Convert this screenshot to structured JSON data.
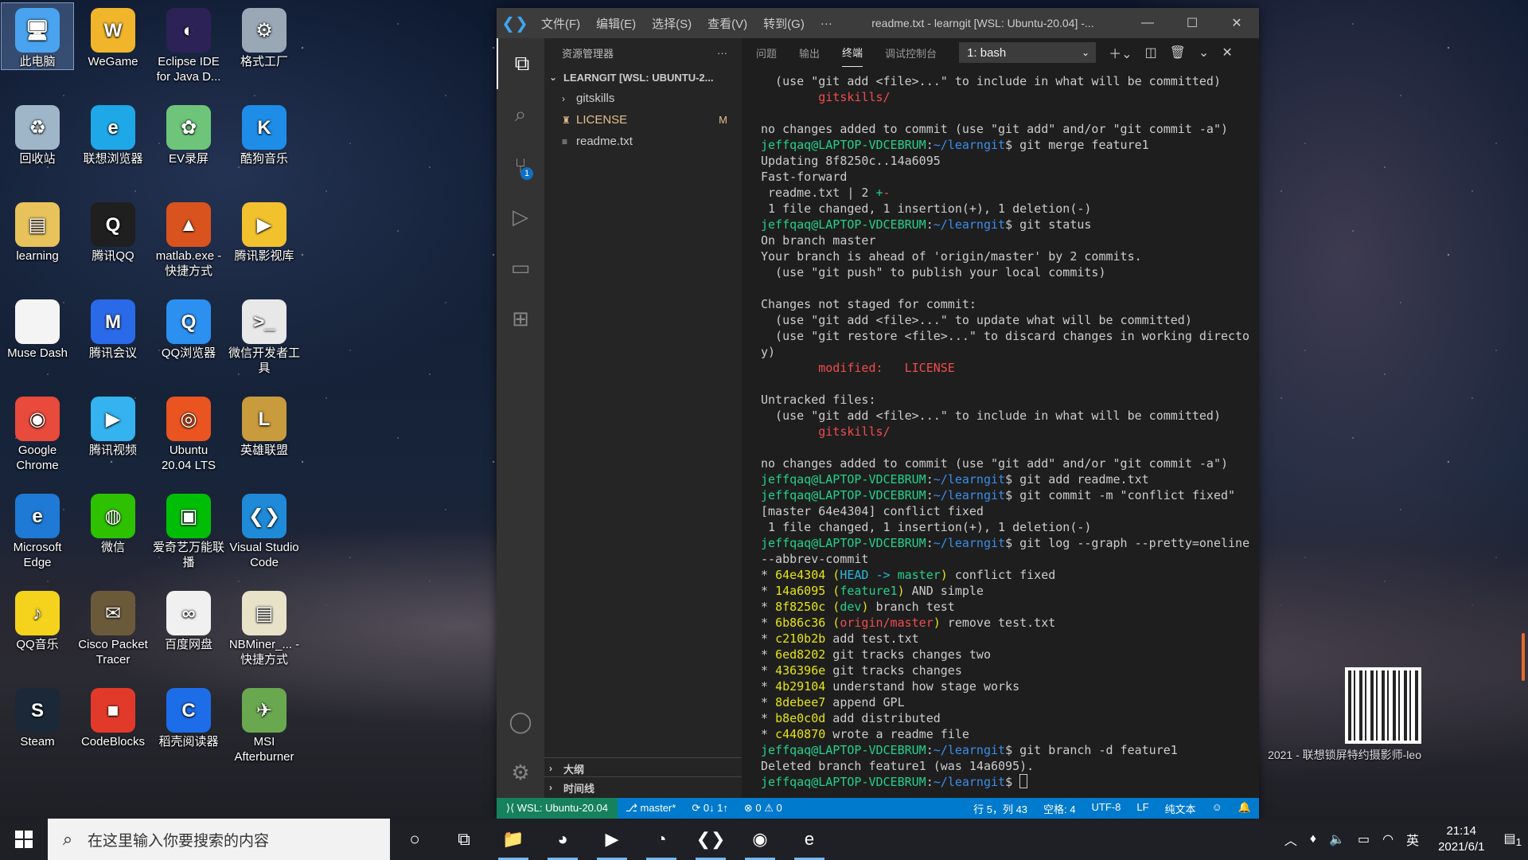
{
  "desktop": {
    "icons": [
      {
        "label": "此电脑",
        "color": "#4aa3ef",
        "glyph": "🖥"
      },
      {
        "label": "WeGame",
        "color": "#f0b52b",
        "glyph": "W"
      },
      {
        "label": "Eclipse IDE for Java D...",
        "color": "#2c2255",
        "glyph": "◐"
      },
      {
        "label": "格式工厂",
        "color": "#9aa7b5",
        "glyph": "⚙"
      },
      {
        "label": "回收站",
        "color": "#9fb6c8",
        "glyph": "♻"
      },
      {
        "label": "联想浏览器",
        "color": "#1ea8e8",
        "glyph": "e"
      },
      {
        "label": "EV录屏",
        "color": "#6ec57a",
        "glyph": "✿"
      },
      {
        "label": "酷狗音乐",
        "color": "#1d8de8",
        "glyph": "K"
      },
      {
        "label": "learning",
        "color": "#e8c25a",
        "glyph": "▤"
      },
      {
        "label": "腾讯QQ",
        "color": "#1f1f1f",
        "glyph": "Q"
      },
      {
        "label": "matlab.exe - 快捷方式",
        "color": "#d9531e",
        "glyph": "▲"
      },
      {
        "label": "腾讯影视库",
        "color": "#f2c12e",
        "glyph": "▶"
      },
      {
        "label": "Muse Dash",
        "color": "#f4f4f4",
        "glyph": " "
      },
      {
        "label": "腾讯会议",
        "color": "#2a6ae8",
        "glyph": "M"
      },
      {
        "label": "QQ浏览器",
        "color": "#2c90f0",
        "glyph": "Q"
      },
      {
        "label": "微信开发者工具",
        "color": "#e8e8e8",
        "glyph": ">_"
      },
      {
        "label": "Google Chrome",
        "color": "#e84a3c",
        "glyph": "◉"
      },
      {
        "label": "腾讯视频",
        "color": "#34b3f0",
        "glyph": "▶"
      },
      {
        "label": "Ubuntu 20.04 LTS",
        "color": "#e95420",
        "glyph": "◎"
      },
      {
        "label": "英雄联盟",
        "color": "#c89b3c",
        "glyph": "L"
      },
      {
        "label": "Microsoft Edge",
        "color": "#1e7ad4",
        "glyph": "e"
      },
      {
        "label": "微信",
        "color": "#2dc100",
        "glyph": "◍"
      },
      {
        "label": "爱奇艺万能联播",
        "color": "#00be06",
        "glyph": "▣"
      },
      {
        "label": "Visual Studio Code",
        "color": "#1f8ad8",
        "glyph": "❮❯"
      },
      {
        "label": "QQ音乐",
        "color": "#f5d21c",
        "glyph": "♪"
      },
      {
        "label": "Cisco Packet Tracer",
        "color": "#6b5a3a",
        "glyph": "✉"
      },
      {
        "label": "百度网盘",
        "color": "#f0f0f0",
        "glyph": "∞"
      },
      {
        "label": "NBMiner_... - 快捷方式",
        "color": "#e8e2c8",
        "glyph": "▤"
      },
      {
        "label": "Steam",
        "color": "#1b2838",
        "glyph": "S"
      },
      {
        "label": "CodeBlocks",
        "color": "#e23a2a",
        "glyph": "■"
      },
      {
        "label": "稻壳阅读器",
        "color": "#1e6de8",
        "glyph": "C"
      },
      {
        "label": "MSI Afterburner",
        "color": "#6aa84f",
        "glyph": "✈"
      }
    ],
    "watermark": "2021 - 联想锁屏特约摄影师-leo"
  },
  "vscode": {
    "menu": [
      "文件(F)",
      "编辑(E)",
      "选择(S)",
      "查看(V)",
      "转到(G)",
      "···"
    ],
    "title": "readme.txt - learngit [WSL: Ubuntu-20.04] -...",
    "sidebar": {
      "header": "资源管理器",
      "more": "···",
      "folder": "LEARNGIT [WSL: UBUNTU-2...",
      "items": [
        {
          "label": "gitskills",
          "kind": "folder",
          "mark": ""
        },
        {
          "label": "LICENSE",
          "kind": "file",
          "mark": "M"
        },
        {
          "label": "readme.txt",
          "kind": "file",
          "mark": ""
        }
      ],
      "outline": "大纲",
      "timeline": "时间线"
    },
    "panel": {
      "tabs": [
        "问题",
        "输出",
        "终端",
        "调试控制台"
      ],
      "active_tab": "终端",
      "terminal_select": "1: bash"
    },
    "terminal_lines": [
      [
        [
          "  (use \"git add <file>...\" to include in what will be committed)",
          ""
        ]
      ],
      [
        [
          "        ",
          ""
        ],
        [
          "gitskills/",
          "r"
        ]
      ],
      [
        [
          "",
          ""
        ]
      ],
      [
        [
          "no changes added to commit (use \"git add\" and/or \"git commit -a\")",
          ""
        ]
      ],
      [
        [
          "jeffqaq@LAPTOP-VDCEBRUM",
          "g"
        ],
        [
          ":",
          ""
        ],
        [
          "~/learngit",
          "b"
        ],
        [
          "$ git merge feature1",
          ""
        ]
      ],
      [
        [
          "Updating 8f8250c..14a6095",
          ""
        ]
      ],
      [
        [
          "Fast-forward",
          ""
        ]
      ],
      [
        [
          " readme.txt | 2 ",
          ""
        ],
        [
          "+",
          "g"
        ],
        [
          "-",
          "r"
        ]
      ],
      [
        [
          " 1 file changed, 1 insertion(+), 1 deletion(-)",
          ""
        ]
      ],
      [
        [
          "jeffqaq@LAPTOP-VDCEBRUM",
          "g"
        ],
        [
          ":",
          ""
        ],
        [
          "~/learngit",
          "b"
        ],
        [
          "$ git status",
          ""
        ]
      ],
      [
        [
          "On branch master",
          ""
        ]
      ],
      [
        [
          "Your branch is ahead of 'origin/master' by 2 commits.",
          ""
        ]
      ],
      [
        [
          "  (use \"git push\" to publish your local commits)",
          ""
        ]
      ],
      [
        [
          "",
          ""
        ]
      ],
      [
        [
          "Changes not staged for commit:",
          ""
        ]
      ],
      [
        [
          "  (use \"git add <file>...\" to update what will be committed)",
          ""
        ]
      ],
      [
        [
          "  (use \"git restore <file>...\" to discard changes in working director",
          ""
        ]
      ],
      [
        [
          "y)",
          ""
        ]
      ],
      [
        [
          "        ",
          ""
        ],
        [
          "modified:   LICENSE",
          "r"
        ]
      ],
      [
        [
          "",
          ""
        ]
      ],
      [
        [
          "Untracked files:",
          ""
        ]
      ],
      [
        [
          "  (use \"git add <file>...\" to include in what will be committed)",
          ""
        ]
      ],
      [
        [
          "        ",
          ""
        ],
        [
          "gitskills/",
          "r"
        ]
      ],
      [
        [
          "",
          ""
        ]
      ],
      [
        [
          "no changes added to commit (use \"git add\" and/or \"git commit -a\")",
          ""
        ]
      ],
      [
        [
          "jeffqaq@LAPTOP-VDCEBRUM",
          "g"
        ],
        [
          ":",
          ""
        ],
        [
          "~/learngit",
          "b"
        ],
        [
          "$ git add readme.txt",
          ""
        ]
      ],
      [
        [
          "jeffqaq@LAPTOP-VDCEBRUM",
          "g"
        ],
        [
          ":",
          ""
        ],
        [
          "~/learngit",
          "b"
        ],
        [
          "$ git commit -m \"conflict fixed\"",
          ""
        ]
      ],
      [
        [
          "[master 64e4304] conflict fixed",
          ""
        ]
      ],
      [
        [
          " 1 file changed, 1 insertion(+), 1 deletion(-)",
          ""
        ]
      ],
      [
        [
          "jeffqaq@LAPTOP-VDCEBRUM",
          "g"
        ],
        [
          ":",
          ""
        ],
        [
          "~/learngit",
          "b"
        ],
        [
          "$ git log --graph --pretty=oneline",
          ""
        ]
      ],
      [
        [
          "--abbrev-commit",
          ""
        ]
      ],
      [
        [
          "* ",
          ""
        ],
        [
          "64e4304",
          "y"
        ],
        [
          " (",
          "y"
        ],
        [
          "HEAD -> ",
          "c"
        ],
        [
          "master",
          "g"
        ],
        [
          ")",
          "y"
        ],
        [
          " conflict fixed",
          ""
        ]
      ],
      [
        [
          "* ",
          ""
        ],
        [
          "14a6095",
          "y"
        ],
        [
          " (",
          "y"
        ],
        [
          "feature1",
          "g"
        ],
        [
          ")",
          "y"
        ],
        [
          " AND simple",
          ""
        ]
      ],
      [
        [
          "* ",
          ""
        ],
        [
          "8f8250c",
          "y"
        ],
        [
          " (",
          "y"
        ],
        [
          "dev",
          "g"
        ],
        [
          ")",
          "y"
        ],
        [
          " branch test",
          ""
        ]
      ],
      [
        [
          "* ",
          ""
        ],
        [
          "6b86c36",
          "y"
        ],
        [
          " (",
          "y"
        ],
        [
          "origin/master",
          "r"
        ],
        [
          ")",
          "y"
        ],
        [
          " remove test.txt",
          ""
        ]
      ],
      [
        [
          "* ",
          ""
        ],
        [
          "c210b2b",
          "y"
        ],
        [
          " add test.txt",
          ""
        ]
      ],
      [
        [
          "* ",
          ""
        ],
        [
          "6ed8202",
          "y"
        ],
        [
          " git tracks changes two",
          ""
        ]
      ],
      [
        [
          "* ",
          ""
        ],
        [
          "436396e",
          "y"
        ],
        [
          " git tracks changes",
          ""
        ]
      ],
      [
        [
          "* ",
          ""
        ],
        [
          "4b29104",
          "y"
        ],
        [
          " understand how stage works",
          ""
        ]
      ],
      [
        [
          "* ",
          ""
        ],
        [
          "8debee7",
          "y"
        ],
        [
          " append GPL",
          ""
        ]
      ],
      [
        [
          "* ",
          ""
        ],
        [
          "b8e0c0d",
          "y"
        ],
        [
          " add distributed",
          ""
        ]
      ],
      [
        [
          "* ",
          ""
        ],
        [
          "c440870",
          "y"
        ],
        [
          " wrote a readme file",
          ""
        ]
      ],
      [
        [
          "jeffqaq@LAPTOP-VDCEBRUM",
          "g"
        ],
        [
          ":",
          ""
        ],
        [
          "~/learngit",
          "b"
        ],
        [
          "$ git branch -d feature1",
          ""
        ]
      ],
      [
        [
          "Deleted branch feature1 (was 14a6095).",
          ""
        ]
      ],
      [
        [
          "jeffqaq@LAPTOP-VDCEBRUM",
          "g"
        ],
        [
          ":",
          ""
        ],
        [
          "~/learngit",
          "b"
        ],
        [
          "$ ",
          ""
        ]
      ]
    ],
    "statusbar": {
      "remote": "⟩⟨ WSL: Ubuntu-20.04",
      "branch": "⎇ master*",
      "sync": "⟳ 0↓ 1↑",
      "problems": "⊗ 0 ⚠ 0",
      "position": "行 5，列 43",
      "spaces": "空格: 4",
      "encoding": "UTF-8",
      "eol": "LF",
      "language": "纯文本"
    }
  },
  "taskbar": {
    "search_placeholder": "在这里输入你要搜索的内容",
    "apps": [
      {
        "name": "cortana-icon",
        "glyph": "○",
        "open": false
      },
      {
        "name": "task-view-icon",
        "glyph": "⧉",
        "open": false
      },
      {
        "name": "file-explorer-icon",
        "glyph": "📁",
        "open": true
      },
      {
        "name": "qq-browser-icon",
        "glyph": "◕",
        "open": true
      },
      {
        "name": "tencent-video-icon",
        "glyph": "▶",
        "open": true
      },
      {
        "name": "ubuntu-icon",
        "glyph": "◔",
        "open": true
      },
      {
        "name": "vscode-icon",
        "glyph": "❮❯",
        "open": true
      },
      {
        "name": "chrome-icon",
        "glyph": "◉",
        "open": true
      },
      {
        "name": "lenovo-browser-icon",
        "glyph": "e",
        "open": true
      }
    ],
    "ime": "英",
    "time": "21:14",
    "date": "2021/6/1",
    "notification_count": "1"
  },
  "colors": {
    "vscode_accent": "#007acc",
    "remote_green": "#16825d",
    "terminal_green": "#23d18b",
    "terminal_blue": "#3b8eea",
    "terminal_red": "#f14c4c",
    "terminal_yellow": "#e5e510"
  }
}
